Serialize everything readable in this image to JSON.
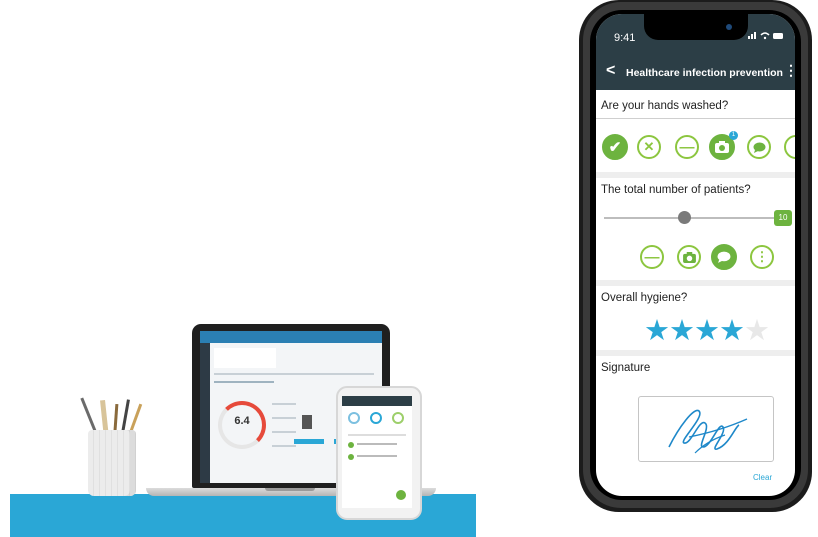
{
  "left_scene": {
    "laptop_value": "6.4"
  },
  "phone": {
    "status_time": "9:41",
    "appbar": {
      "back": "<",
      "title": "Healthcare infection prevention",
      "menu": "⋮"
    },
    "q1": {
      "text": "Are your hands washed?",
      "photo_badge": "1"
    },
    "q2": {
      "text": "The total number of patients?",
      "slider_value": "10",
      "slider_level": 0.45
    },
    "q3": {
      "text": "Overall hygiene?",
      "rating": 4,
      "rating_max": 5
    },
    "q4": {
      "text": "Signature",
      "clear_label": "Clear"
    },
    "colors": {
      "accent_green": "#6db33f",
      "accent_blue": "#2aa7d6",
      "appbar_dark": "#2c3e46"
    }
  }
}
